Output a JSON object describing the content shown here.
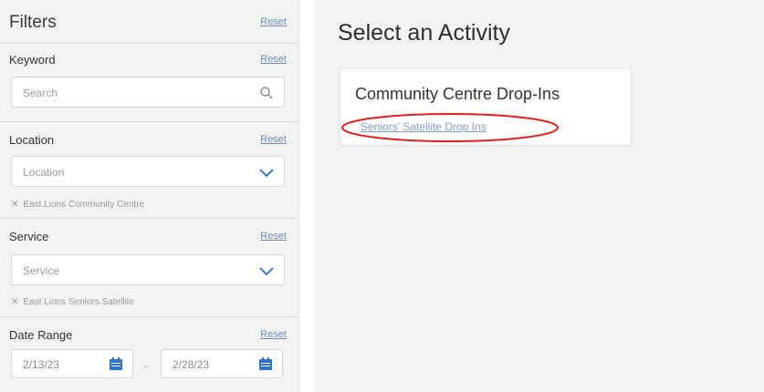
{
  "filters": {
    "title": "Filters",
    "reset_label": "Reset",
    "keyword": {
      "label": "Keyword",
      "reset": "Reset",
      "placeholder": "Search"
    },
    "location": {
      "label": "Location",
      "reset": "Reset",
      "placeholder": "Location",
      "selected_chip": "East Lions Community Centre"
    },
    "service": {
      "label": "Service",
      "reset": "Reset",
      "placeholder": "Service",
      "selected_chip": "East Lions Seniors Satellite"
    },
    "date_range": {
      "label": "Date Range",
      "reset": "Reset",
      "start": "2/13/23",
      "end": "2/28/23",
      "separator": "-"
    }
  },
  "main": {
    "title": "Select an Activity",
    "card": {
      "title": "Community Centre Drop-Ins",
      "link": "Seniors' Satellite Drop Ins"
    }
  },
  "icons": {
    "search": "search-icon",
    "dropdown": "chevron-down-icon",
    "remove": "close-icon",
    "calendar": "calendar-icon",
    "annotation": "red-ellipse-highlight"
  },
  "colors": {
    "link": "#7d9dc6",
    "chevron": "#3f79c4",
    "calendar": "#2f73c9",
    "annotation": "#e02020",
    "panel": "#f3f3f3"
  }
}
